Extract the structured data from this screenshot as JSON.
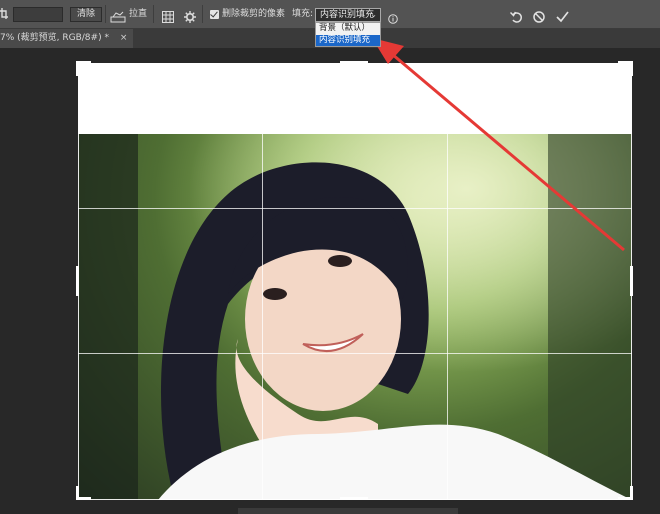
{
  "options_bar": {
    "clear_label": "清除",
    "straighten_label": "拉直",
    "delete_cropped_label": "删除裁剪的像素",
    "delete_cropped_checked": true,
    "fill_label": "填充:",
    "fill_selected": "内容识别填充",
    "fill_options": [
      "背景（默认）",
      "内容识别填充"
    ],
    "fill_highlighted_index": 1
  },
  "document_tab": {
    "title": "7% (裁剪预览, RGB/8#) *"
  },
  "icons": {
    "tool": "crop-tool-icon",
    "straighten": "straighten-icon",
    "grid": "grid-overlay-icon",
    "settings": "gear-icon",
    "info": "info-icon",
    "reset": "reset-icon",
    "cancel": "cancel-icon",
    "commit": "checkmark-icon",
    "close_tab": "close-icon"
  },
  "colors": {
    "annotation_arrow": "#e53935",
    "selection_highlight": "#1b67c9"
  }
}
